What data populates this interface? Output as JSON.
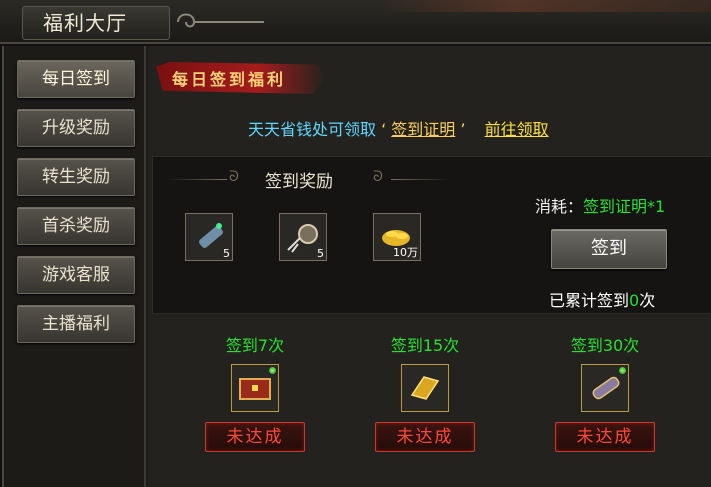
{
  "window": {
    "title": "福利大厅"
  },
  "sidebar": {
    "items": [
      {
        "label": "每日签到"
      },
      {
        "label": "升级奖励"
      },
      {
        "label": "转生奖励"
      },
      {
        "label": "首杀奖励"
      },
      {
        "label": "游戏客服"
      },
      {
        "label": "主播福利"
      }
    ]
  },
  "banner": {
    "text": "每日签到福利"
  },
  "hint": {
    "text": "天天省钱处可领取",
    "quote_open": "‘",
    "item_link": "签到证明",
    "quote_close": "’",
    "go_link": "前往领取"
  },
  "rewards": {
    "title": "签到奖励",
    "items": [
      {
        "icon": "flare-scroll-icon",
        "count": "5"
      },
      {
        "icon": "rope-bell-icon",
        "count": "5"
      },
      {
        "icon": "gold-coins-icon",
        "count": "10万"
      }
    ],
    "cost_label": "消耗：",
    "cost_value": "签到证明*1",
    "sign_button": "签到",
    "accum_prefix": "已累计签到",
    "accum_count": "0",
    "accum_suffix": "次"
  },
  "milestones": [
    {
      "label": "签到7次",
      "icon": "treasure-chest-icon",
      "status": "未达成"
    },
    {
      "label": "签到15次",
      "icon": "gold-ingot-icon",
      "status": "未达成"
    },
    {
      "label": "签到30次",
      "icon": "scroll-icon",
      "status": "未达成"
    }
  ],
  "colors": {
    "accent_green": "#28e12f",
    "link_yellow": "#ffcf5a",
    "hint_cyan": "#5fd7ff",
    "alert_red": "#ff4a3a"
  }
}
